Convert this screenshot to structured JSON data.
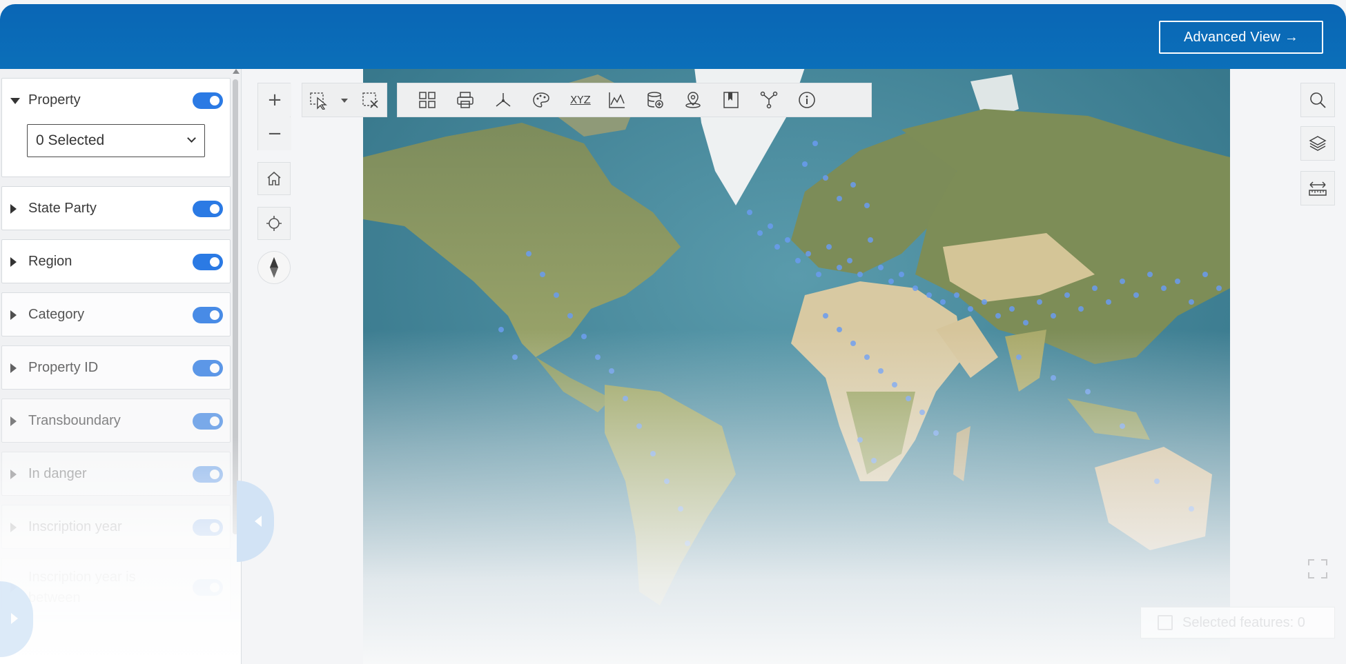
{
  "header": {
    "advanced_view_label": "Advanced View →"
  },
  "filters": [
    {
      "label": "Property",
      "expanded": true,
      "enabled": true,
      "opacity": 1.0
    },
    {
      "label": "State Party",
      "expanded": false,
      "enabled": true,
      "opacity": 1.0
    },
    {
      "label": "Region",
      "expanded": false,
      "enabled": true,
      "opacity": 1.0
    },
    {
      "label": "Category",
      "expanded": false,
      "enabled": true,
      "opacity": 0.85
    },
    {
      "label": "Property ID",
      "expanded": false,
      "enabled": true,
      "opacity": 0.75
    },
    {
      "label": "Transboundary",
      "expanded": false,
      "enabled": true,
      "opacity": 0.6
    },
    {
      "label": "In danger",
      "expanded": false,
      "enabled": true,
      "opacity": 0.45
    },
    {
      "label": "Inscription year",
      "expanded": false,
      "enabled": true,
      "opacity": 0.32
    },
    {
      "label": "Inscription year is between",
      "expanded": false,
      "enabled": true,
      "opacity": 0.18
    }
  ],
  "property_select": {
    "value": "0 Selected"
  },
  "map_controls": {
    "zoom_in": "+",
    "zoom_out": "−",
    "home": "home-icon",
    "locate": "locate-icon",
    "compass": "compass-icon"
  },
  "toolbar": {
    "tools": [
      "grid-icon",
      "print-icon",
      "measure-icon",
      "symbology-icon",
      "xyz-icon",
      "elevation-profile-icon",
      "add-data-icon",
      "location-icon",
      "bookmark-icon",
      "share-icon",
      "info-icon"
    ],
    "xyz_label": "XYZ"
  },
  "right_tools": [
    "search-icon",
    "layers-icon",
    "measure-distance-icon"
  ],
  "status": {
    "selected_features_label": "Selected features: 0"
  },
  "colors": {
    "header": "#0a66b5",
    "toggle": "#2b7ae4",
    "ocean": "#3b7f93",
    "land": "#8a9a5b",
    "desert": "#d8c9a2",
    "ice": "#f2f4f5",
    "points": "#6a9cf0"
  }
}
